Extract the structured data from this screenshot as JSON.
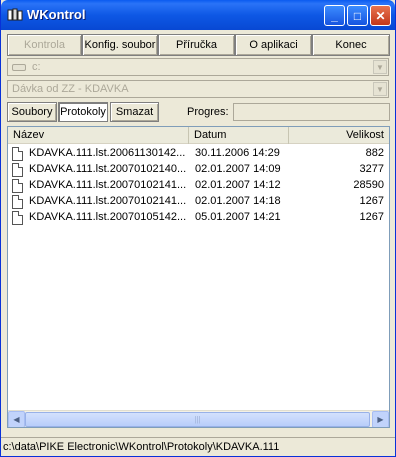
{
  "window": {
    "title": "WKontrol",
    "controls": {
      "minimize": "_",
      "maximize": "□",
      "close": "✕"
    }
  },
  "toolbar": {
    "buttons": [
      {
        "label": "Kontrola",
        "enabled": false
      },
      {
        "label": "Konfig. soubor",
        "enabled": true
      },
      {
        "label": "Příručka",
        "enabled": true
      },
      {
        "label": "O aplikaci",
        "enabled": true
      },
      {
        "label": "Konec",
        "enabled": true
      }
    ]
  },
  "drive_combo": {
    "value": "c:",
    "icon": "drive-icon"
  },
  "batch_combo": {
    "value": "Dávka od ZZ - KDAVKA"
  },
  "tabs": {
    "items": [
      {
        "label": "Soubory",
        "selected": false
      },
      {
        "label": "Protokoly",
        "selected": true
      },
      {
        "label": "Smazat",
        "selected": false
      }
    ]
  },
  "progress": {
    "label": "Progres:",
    "value": ""
  },
  "list": {
    "columns": [
      "Název",
      "Datum",
      "Velikost"
    ],
    "rows": [
      {
        "name": "KDAVKA.111.lst.20061130142...",
        "date": "30.11.2006 14:29",
        "size": "882"
      },
      {
        "name": "KDAVKA.111.lst.20070102140...",
        "date": "02.01.2007 14:09",
        "size": "3277"
      },
      {
        "name": "KDAVKA.111.lst.20070102141...",
        "date": "02.01.2007 14:12",
        "size": "28590"
      },
      {
        "name": "KDAVKA.111.lst.20070102141...",
        "date": "02.01.2007 14:18",
        "size": "1267"
      },
      {
        "name": "KDAVKA.111.lst.20070105142...",
        "date": "05.01.2007 14:21",
        "size": "1267"
      }
    ]
  },
  "scrollbar": {
    "left_arrow": "◀",
    "right_arrow": "▶",
    "grip": "|||"
  },
  "status": {
    "path": "c:\\data\\PIKE Electronic\\WKontrol\\Protokoly\\KDAVKA.111"
  },
  "colors": {
    "title_blue": "#0848d3",
    "close_red": "#c2371a",
    "face": "#ece9d8"
  }
}
